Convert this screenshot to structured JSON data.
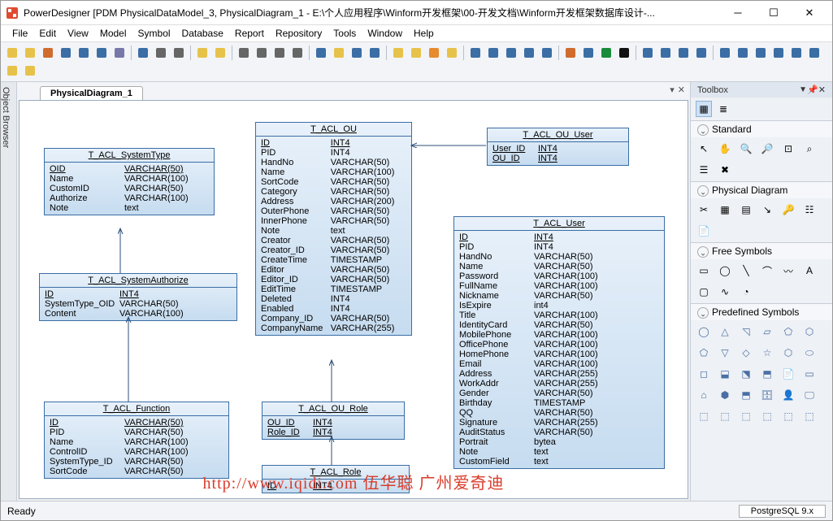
{
  "title": "PowerDesigner [PDM PhysicalDataModel_3, PhysicalDiagram_1 - E:\\个人应用程序\\Winform开发框架\\00-开发文档\\Winform开发框架数据库设计-...",
  "menu": [
    "File",
    "Edit",
    "View",
    "Model",
    "Symbol",
    "Database",
    "Report",
    "Repository",
    "Tools",
    "Window",
    "Help"
  ],
  "doc_tab": "PhysicalDiagram_1",
  "side_tab": "Object Browser",
  "toolbox": {
    "title": "Toolbox",
    "sections": [
      "Standard",
      "Physical Diagram",
      "Free Symbols",
      "Predefined Symbols"
    ]
  },
  "status": {
    "left": "Ready",
    "db": "PostgreSQL 9.x"
  },
  "watermark": "http://www.iqidi.com 伍华聪 广州爱奇迪",
  "tables": {
    "systemType": {
      "name": "T_ACL_SystemType",
      "rows": [
        [
          "OID",
          "VARCHAR(50)",
          "<pk>",
          true
        ],
        [
          "Name",
          "VARCHAR(100)",
          "",
          false
        ],
        [
          "CustomID",
          "VARCHAR(50)",
          "",
          false
        ],
        [
          "Authorize",
          "VARCHAR(100)",
          "",
          false
        ],
        [
          "Note",
          "text",
          "",
          false
        ]
      ]
    },
    "systemAuthorize": {
      "name": "T_ACL_SystemAuthorize",
      "rows": [
        [
          "ID",
          "INT4",
          "<pk>",
          true
        ],
        [
          "SystemType_OID",
          "VARCHAR(50)",
          "<fk>",
          false
        ],
        [
          "Content",
          "VARCHAR(100)",
          "",
          false
        ]
      ]
    },
    "function": {
      "name": "T_ACL_Function",
      "rows": [
        [
          "ID",
          "VARCHAR(50)",
          "<pk>",
          true
        ],
        [
          "PID",
          "VARCHAR(50)",
          "",
          false
        ],
        [
          "Name",
          "VARCHAR(100)",
          "",
          false
        ],
        [
          "ControlID",
          "VARCHAR(100)",
          "",
          false
        ],
        [
          "SystemType_ID",
          "VARCHAR(50)",
          "",
          false
        ],
        [
          "SortCode",
          "VARCHAR(50)",
          "",
          false
        ]
      ]
    },
    "ou": {
      "name": "T_ACL_OU",
      "rows": [
        [
          "ID",
          "INT4",
          "<pk>",
          true
        ],
        [
          "PID",
          "INT4",
          "",
          false
        ],
        [
          "HandNo",
          "VARCHAR(50)",
          "",
          false
        ],
        [
          "Name",
          "VARCHAR(100)",
          "",
          false
        ],
        [
          "SortCode",
          "VARCHAR(50)",
          "",
          false
        ],
        [
          "Category",
          "VARCHAR(50)",
          "",
          false
        ],
        [
          "Address",
          "VARCHAR(200)",
          "",
          false
        ],
        [
          "OuterPhone",
          "VARCHAR(50)",
          "",
          false
        ],
        [
          "InnerPhone",
          "VARCHAR(50)",
          "",
          false
        ],
        [
          "Note",
          "text",
          "",
          false
        ],
        [
          "Creator",
          "VARCHAR(50)",
          "",
          false
        ],
        [
          "Creator_ID",
          "VARCHAR(50)",
          "",
          false
        ],
        [
          "CreateTime",
          "TIMESTAMP",
          "",
          false
        ],
        [
          "Editor",
          "VARCHAR(50)",
          "",
          false
        ],
        [
          "Editor_ID",
          "VARCHAR(50)",
          "",
          false
        ],
        [
          "EditTime",
          "TIMESTAMP",
          "",
          false
        ],
        [
          "Deleted",
          "INT4",
          "",
          false
        ],
        [
          "Enabled",
          "INT4",
          "",
          false
        ],
        [
          "Company_ID",
          "VARCHAR(50)",
          "",
          false
        ],
        [
          "CompanyName",
          "VARCHAR(255)",
          "",
          false
        ]
      ]
    },
    "ouUser": {
      "name": "T_ACL_OU_User",
      "rows": [
        [
          "User_ID",
          "INT4",
          "<pk,fk2>",
          true
        ],
        [
          "OU_ID",
          "INT4",
          "<pk,fk1>",
          true
        ]
      ]
    },
    "ouRole": {
      "name": "T_ACL_OU_Role",
      "rows": [
        [
          "OU_ID",
          "INT4",
          "<pk,fk1>",
          true
        ],
        [
          "Role_ID",
          "INT4",
          "<pk,fk2>",
          true
        ]
      ]
    },
    "role": {
      "name": "T_ACL_Role",
      "rows": [
        [
          "ID",
          "INT4",
          "<pk>",
          true
        ]
      ]
    },
    "user": {
      "name": "T_ACL_User",
      "rows": [
        [
          "ID",
          "INT4",
          "<pk>",
          true
        ],
        [
          "PID",
          "INT4",
          "",
          false
        ],
        [
          "HandNo",
          "VARCHAR(50)",
          "",
          false
        ],
        [
          "Name",
          "VARCHAR(50)",
          "",
          false
        ],
        [
          "Password",
          "VARCHAR(100)",
          "",
          false
        ],
        [
          "FullName",
          "VARCHAR(100)",
          "",
          false
        ],
        [
          "Nickname",
          "VARCHAR(50)",
          "",
          false
        ],
        [
          "IsExpire",
          "int4",
          "",
          false
        ],
        [
          "Title",
          "VARCHAR(100)",
          "",
          false
        ],
        [
          "IdentityCard",
          "VARCHAR(50)",
          "",
          false
        ],
        [
          "MobilePhone",
          "VARCHAR(100)",
          "",
          false
        ],
        [
          "OfficePhone",
          "VARCHAR(100)",
          "",
          false
        ],
        [
          "HomePhone",
          "VARCHAR(100)",
          "",
          false
        ],
        [
          "Email",
          "VARCHAR(100)",
          "",
          false
        ],
        [
          "Address",
          "VARCHAR(255)",
          "",
          false
        ],
        [
          "WorkAddr",
          "VARCHAR(255)",
          "",
          false
        ],
        [
          "Gender",
          "VARCHAR(50)",
          "",
          false
        ],
        [
          "Birthday",
          "TIMESTAMP",
          "",
          false
        ],
        [
          "QQ",
          "VARCHAR(50)",
          "",
          false
        ],
        [
          "Signature",
          "VARCHAR(255)",
          "",
          false
        ],
        [
          "AuditStatus",
          "VARCHAR(50)",
          "",
          false
        ],
        [
          "Portrait",
          "bytea",
          "",
          false
        ],
        [
          "Note",
          "text",
          "",
          false
        ],
        [
          "CustomField",
          "text",
          "",
          false
        ]
      ]
    }
  }
}
